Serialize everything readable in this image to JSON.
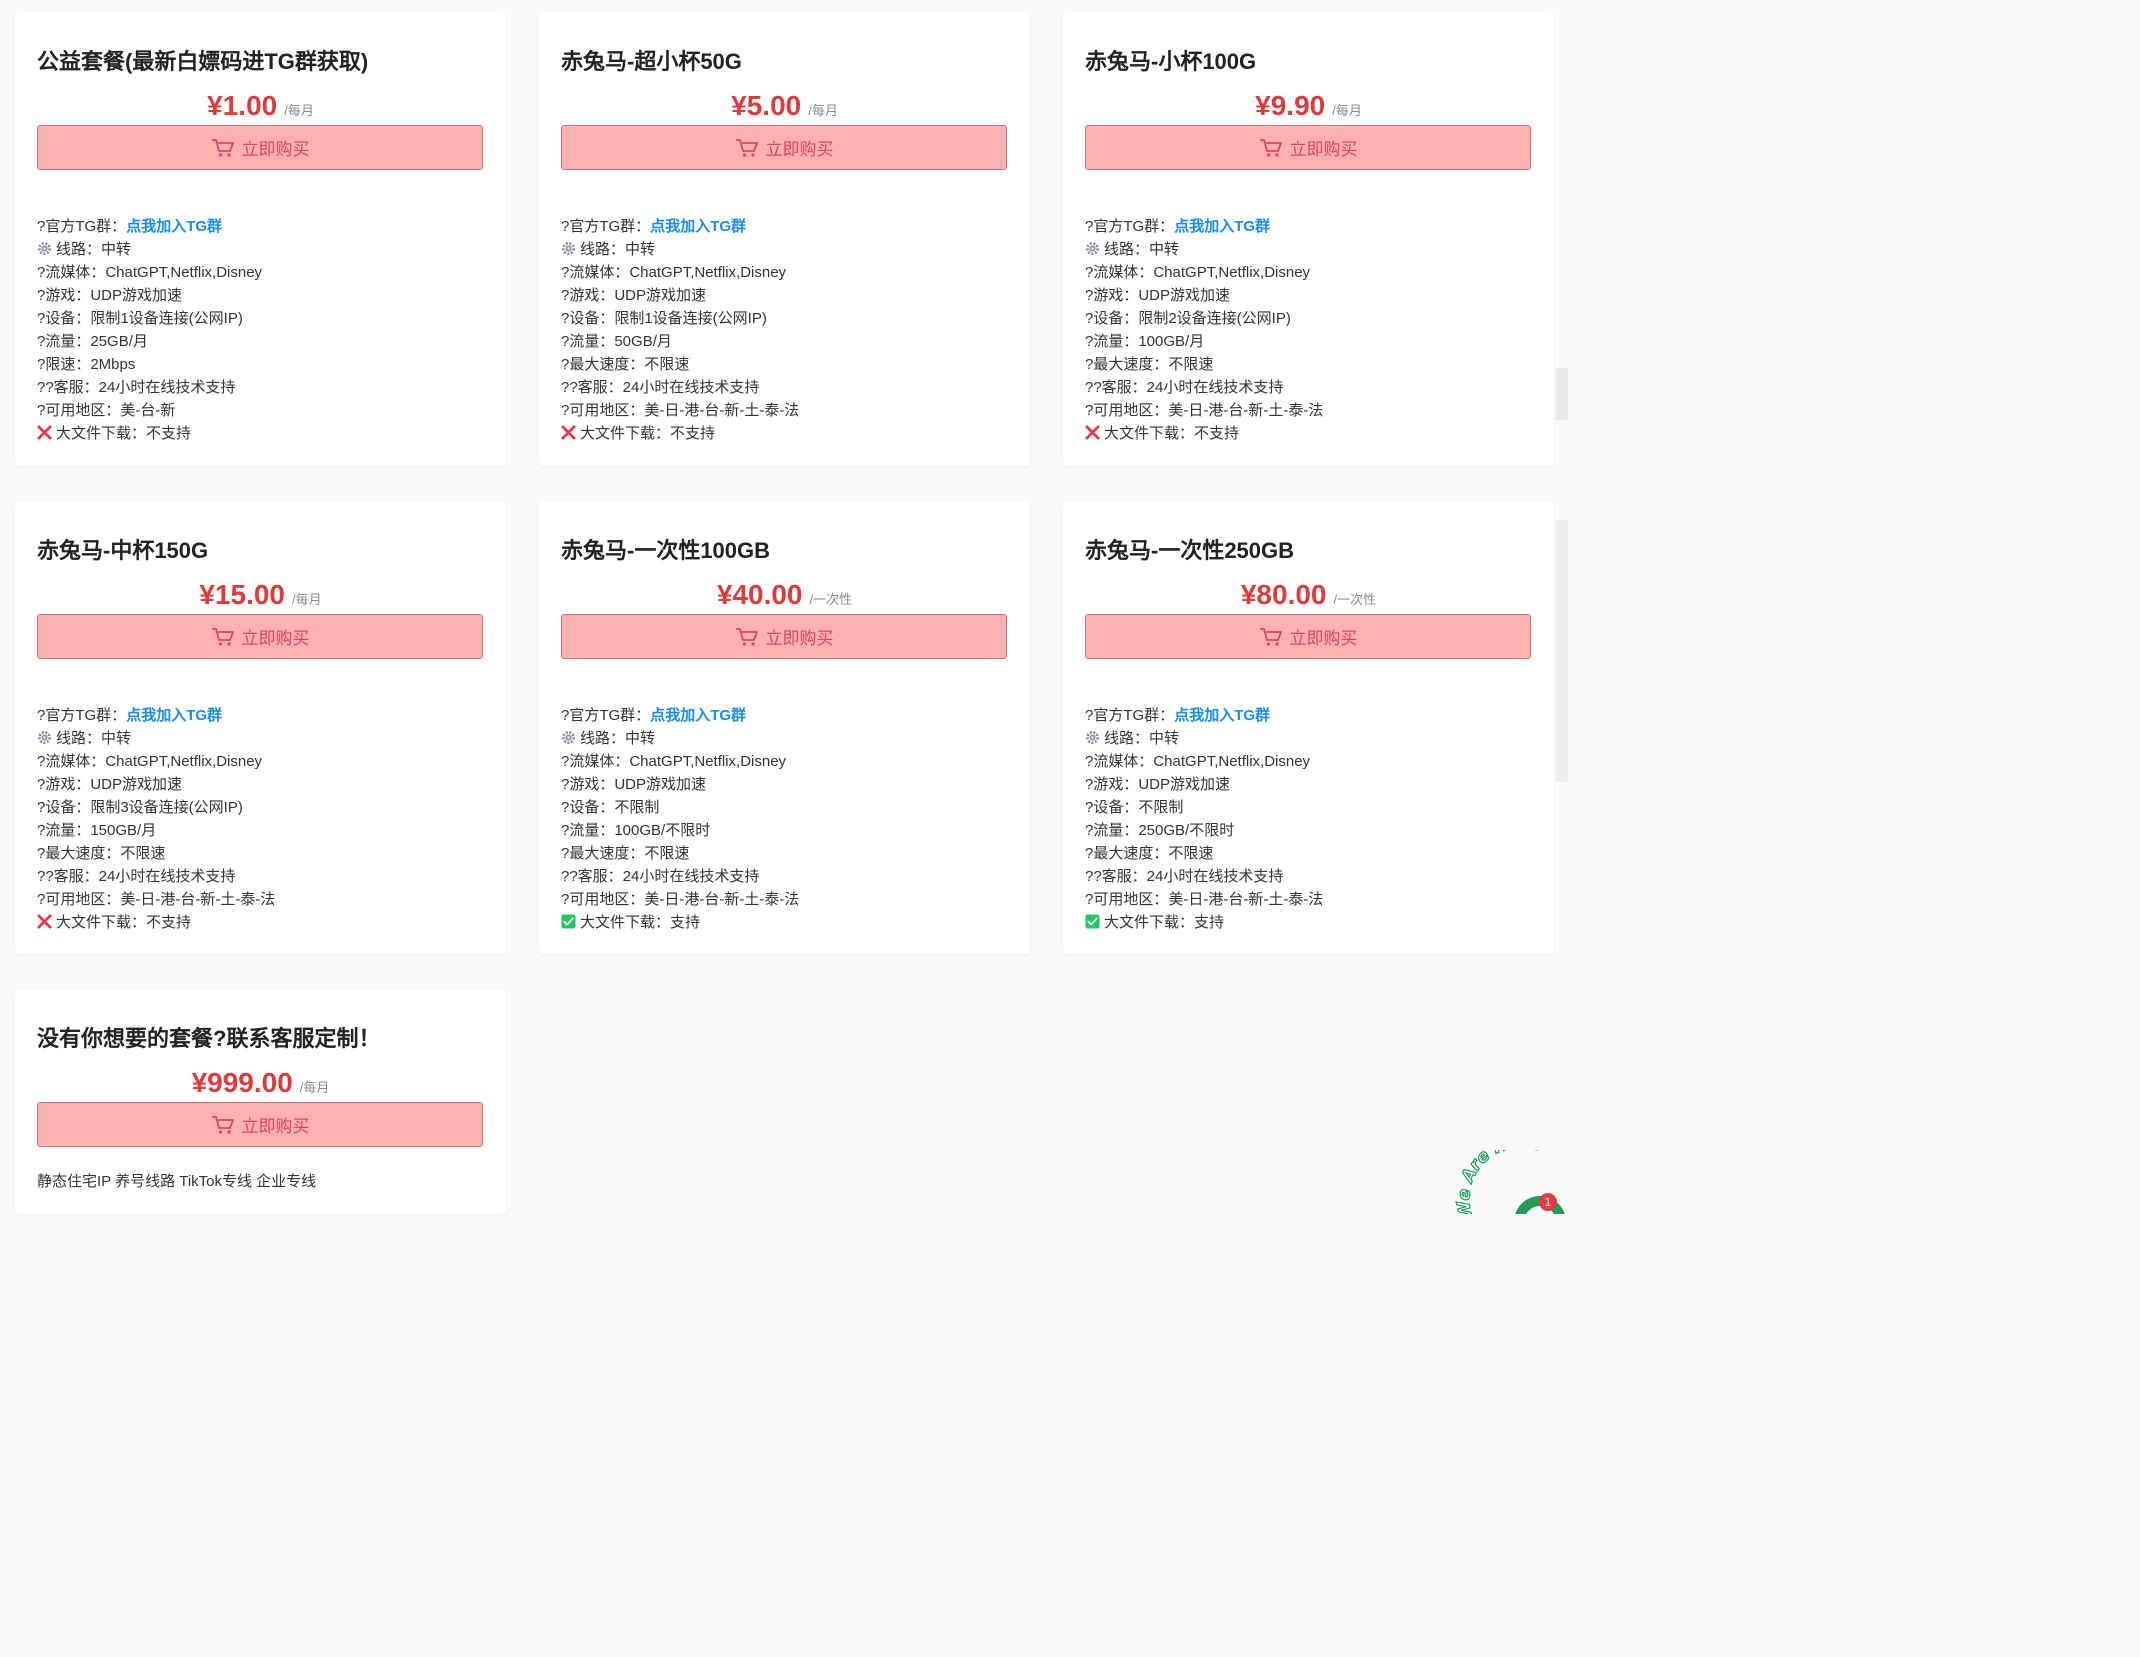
{
  "buy_label": "立即购买",
  "colors": {
    "accent_red": "#e03a3a",
    "button_bg": "#ffb1b1",
    "button_border": "#e0707d",
    "link_blue": "#1a8cf0",
    "check_green": "#22c55e",
    "cross_red": "#e53945"
  },
  "labels": {
    "tg": "?官方TG群：",
    "tg_link": "点我加入TG群",
    "line": "线路：中转",
    "media": "?流媒体：ChatGPT,Netflix,Disney",
    "game": "?游戏：UDP游戏加速",
    "service": "??客服：24小时在线技术支持",
    "region_prefix": "?可用地区：",
    "download_prefix": "大文件下载："
  },
  "plans": [
    {
      "title": "公益套餐(最新白嫖码进TG群获取)",
      "price": "¥1.00",
      "unit": "/每月",
      "device": "?设备：限制1设备连接(公网IP)",
      "traffic": "?流量：25GB/月",
      "speed": "?限速：2Mbps",
      "region": "美-台-新",
      "download": "不支持",
      "download_icon": "cross-icon"
    },
    {
      "title": "赤兔马-超小杯50G",
      "price": "¥5.00",
      "unit": "/每月",
      "device": "?设备：限制1设备连接(公网IP)",
      "traffic": "?流量：50GB/月",
      "speed": "?最大速度：不限速",
      "region": "美-日-港-台-新-土-泰-法",
      "download": "不支持",
      "download_icon": "cross-icon"
    },
    {
      "title": "赤兔马-小杯100G",
      "price": "¥9.90",
      "unit": "/每月",
      "device": "?设备：限制2设备连接(公网IP)",
      "traffic": "?流量：100GB/月",
      "speed": "?最大速度：不限速",
      "region": "美-日-港-台-新-土-泰-法",
      "download": "不支持",
      "download_icon": "cross-icon"
    },
    {
      "title": "赤兔马-中杯150G",
      "price": "¥15.00",
      "unit": "/每月",
      "device": "?设备：限制3设备连接(公网IP)",
      "traffic": "?流量：150GB/月",
      "speed": "?最大速度：不限速",
      "region": "美-日-港-台-新-土-泰-法",
      "download": "不支持",
      "download_icon": "cross-icon"
    },
    {
      "title": "赤兔马-一次性100GB",
      "price": "¥40.00",
      "unit": "/一次性",
      "device": "?设备：不限制",
      "traffic": "?流量：100GB/不限时",
      "speed": "?最大速度：不限速",
      "region": "美-日-港-台-新-土-泰-法",
      "download": "支持",
      "download_icon": "check-icon"
    },
    {
      "title": "赤兔马-一次性250GB",
      "price": "¥80.00",
      "unit": "/一次性",
      "device": "?设备：不限制",
      "traffic": "?流量：250GB/不限时",
      "speed": "?最大速度：不限速",
      "region": "美-日-港-台-新-土-泰-法",
      "download": "支持",
      "download_icon": "check-icon"
    }
  ],
  "custom_plan": {
    "title": "没有你想要的套餐?联系客服定制！",
    "price": "¥999.00",
    "unit": "/每月",
    "text": "静态住宅IP 养号线路 TikTok专线 企业专线"
  },
  "badge": {
    "text": "We Are Here",
    "count": "1"
  }
}
